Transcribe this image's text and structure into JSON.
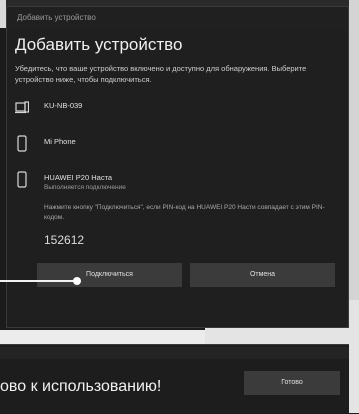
{
  "dialog": {
    "window_title": "Добавить устройство",
    "title": "Добавить устройство",
    "description": "Убедитесь, что ваше устройство включено и доступно для обнаружения. Выберите устройство ниже, чтобы подключиться.",
    "devices": [
      {
        "name": "KU-NB-039",
        "subtitle": "",
        "icon": "laptop-icon"
      },
      {
        "name": "Mi Phone",
        "subtitle": "",
        "icon": "phone-icon"
      },
      {
        "name": "HUAWEI P20 Наста",
        "subtitle": "Выполняется подключение",
        "icon": "phone-icon"
      }
    ],
    "pin_instruction": "Нажмите кнопку \"Подключиться\", если PIN-код на HUAWEI P20 Насти совпадает с этим PIN-кодом.",
    "pin_code": "152612",
    "connect_label": "Подключиться",
    "cancel_label": "Отмена"
  },
  "dialog2": {
    "ready_text": "ово к использованию!",
    "done_label": "Готово"
  }
}
